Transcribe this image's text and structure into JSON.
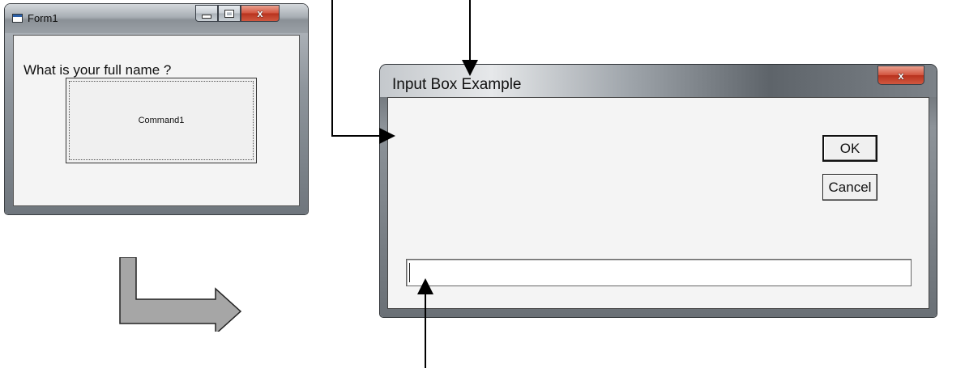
{
  "form1": {
    "title": "Form1",
    "command_button_label": "Command1",
    "close_glyph": "x"
  },
  "input_box": {
    "title": "Input Box Example",
    "prompt": "What is your full name ?",
    "ok_label": "OK",
    "cancel_label": "Cancel",
    "close_glyph": "x",
    "input_value": ""
  },
  "icons": [
    "app-icon",
    "minimize-icon",
    "maximize-icon",
    "close-icon",
    "flow-arrow-icon"
  ],
  "colors": {
    "close_button": "#c8402a",
    "arrow_fill": "#a6a6a6",
    "callout_line": "#000000"
  }
}
